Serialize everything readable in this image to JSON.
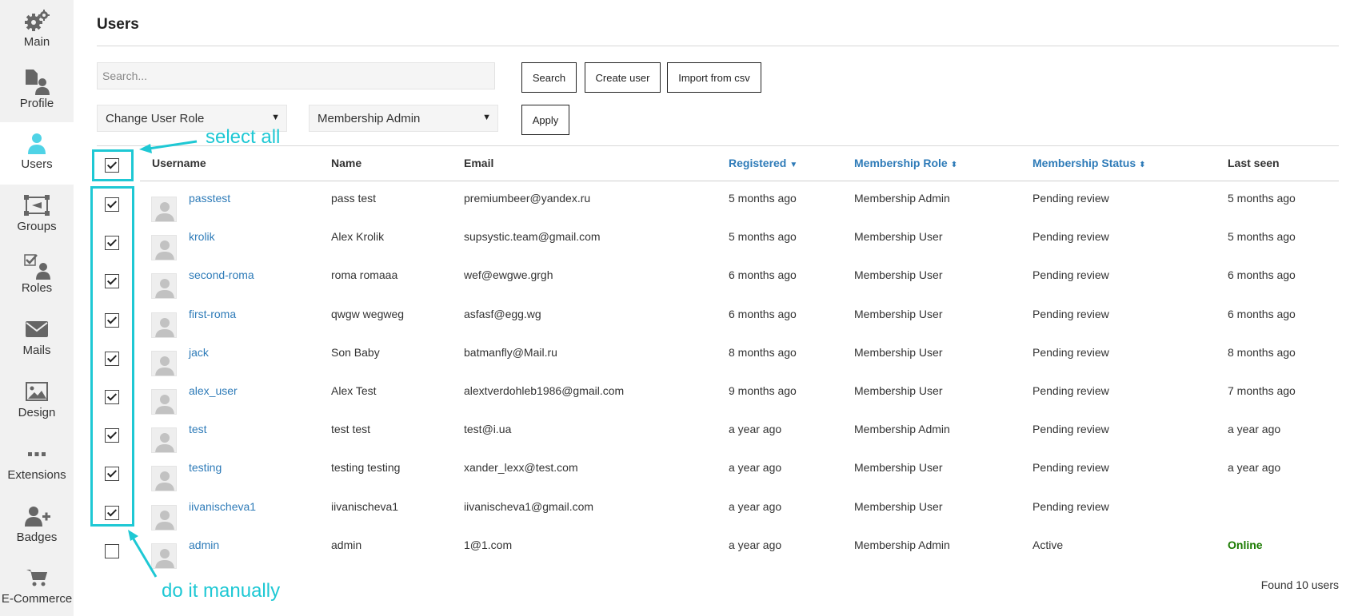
{
  "sidebar": {
    "items": [
      {
        "label": "Main",
        "icon": "gears-icon"
      },
      {
        "label": "Profile",
        "icon": "profile-icon"
      },
      {
        "label": "Users",
        "icon": "user-icon",
        "active": true
      },
      {
        "label": "Groups",
        "icon": "groups-icon"
      },
      {
        "label": "Roles",
        "icon": "roles-icon"
      },
      {
        "label": "Mails",
        "icon": "mail-icon"
      },
      {
        "label": "Design",
        "icon": "image-icon"
      },
      {
        "label": "Extensions",
        "icon": "dots-icon"
      },
      {
        "label": "Badges",
        "icon": "badge-icon"
      },
      {
        "label": "E-Commerce",
        "icon": "cart-icon"
      }
    ]
  },
  "header": {
    "title": "Users"
  },
  "toolbar": {
    "search_placeholder": "Search...",
    "search_label": "Search",
    "create_label": "Create user",
    "import_label": "Import from csv",
    "role_action": "Change User Role",
    "role_value": "Membership Admin",
    "apply_label": "Apply"
  },
  "table": {
    "columns": {
      "username": "Username",
      "name": "Name",
      "email": "Email",
      "registered": "Registered",
      "role": "Membership Role",
      "status": "Membership Status",
      "last_seen": "Last seen"
    },
    "rows": [
      {
        "checked": true,
        "username": "passtest",
        "name": "pass test",
        "email": "premiumbeer@yandex.ru",
        "registered": "5 months ago",
        "role": "Membership Admin",
        "status": "Pending review",
        "last_seen": "5 months ago"
      },
      {
        "checked": true,
        "username": "krolik",
        "name": "Alex Krolik",
        "email": "supsystic.team@gmail.com",
        "registered": "5 months ago",
        "role": "Membership User",
        "status": "Pending review",
        "last_seen": "5 months ago"
      },
      {
        "checked": true,
        "username": "second-roma",
        "name": "roma romaaa",
        "email": "wef@ewgwe.grgh",
        "registered": "6 months ago",
        "role": "Membership User",
        "status": "Pending review",
        "last_seen": "6 months ago"
      },
      {
        "checked": true,
        "username": "first-roma",
        "name": "qwgw wegweg",
        "email": "asfasf@egg.wg",
        "registered": "6 months ago",
        "role": "Membership User",
        "status": "Pending review",
        "last_seen": "6 months ago"
      },
      {
        "checked": true,
        "username": "jack",
        "name": "Son Baby",
        "email": "batmanfly@Mail.ru",
        "registered": "8 months ago",
        "role": "Membership User",
        "status": "Pending review",
        "last_seen": "8 months ago"
      },
      {
        "checked": true,
        "username": "alex_user",
        "name": "Alex Test",
        "email": "alextverdohleb1986@gmail.com",
        "registered": "9 months ago",
        "role": "Membership User",
        "status": "Pending review",
        "last_seen": "7 months ago"
      },
      {
        "checked": true,
        "username": "test",
        "name": "test test",
        "email": "test@i.ua",
        "registered": "a year ago",
        "role": "Membership Admin",
        "status": "Pending review",
        "last_seen": "a year ago"
      },
      {
        "checked": true,
        "username": "testing",
        "name": "testing testing",
        "email": "xander_lexx@test.com",
        "registered": "a year ago",
        "role": "Membership User",
        "status": "Pending review",
        "last_seen": "a year ago"
      },
      {
        "checked": true,
        "username": "iivanischeva1",
        "name": "iivanischeva1",
        "email": "iivanischeva1@gmail.com",
        "registered": "a year ago",
        "role": "Membership User",
        "status": "Pending review",
        "last_seen": ""
      },
      {
        "checked": false,
        "username": "admin",
        "name": "admin",
        "email": "1@1.com",
        "registered": "a year ago",
        "role": "Membership Admin",
        "status": "Active",
        "last_seen": "Online"
      }
    ],
    "footer": "Found 10 users"
  },
  "annotations": {
    "select_all": "select all",
    "manual": "do it manually",
    "color": "#1ec8d4"
  }
}
